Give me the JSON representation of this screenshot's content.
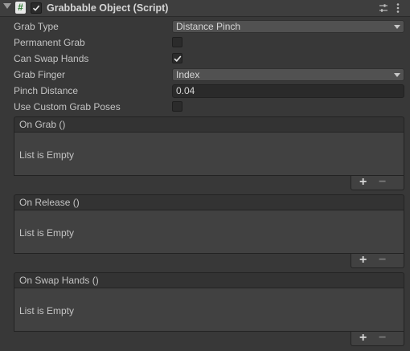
{
  "header": {
    "script_icon_glyph": "#",
    "title": "Grabbable Object (Script)",
    "enabled": true
  },
  "fields": {
    "grab_type": {
      "label": "Grab Type",
      "value": "Distance Pinch"
    },
    "permanent_grab": {
      "label": "Permanent Grab",
      "checked": false
    },
    "can_swap_hands": {
      "label": "Can Swap Hands",
      "checked": true
    },
    "grab_finger": {
      "label": "Grab Finger",
      "value": "Index"
    },
    "pinch_distance": {
      "label": "Pinch Distance",
      "value": "0.04"
    },
    "use_custom_grab_poses": {
      "label": "Use Custom Grab Poses",
      "checked": false
    }
  },
  "events": [
    {
      "title": "On Grab ()",
      "empty_text": "List is Empty",
      "add_label": "+",
      "remove_label": "−"
    },
    {
      "title": "On Release ()",
      "empty_text": "List is Empty",
      "add_label": "+",
      "remove_label": "−"
    },
    {
      "title": "On Swap Hands ()",
      "empty_text": "List is Empty",
      "add_label": "+",
      "remove_label": "−"
    }
  ],
  "icons": {
    "foldout": "triangle-down-icon",
    "script": "script-icon",
    "settings": "sliders-icon",
    "menu": "vertical-dots-icon"
  }
}
